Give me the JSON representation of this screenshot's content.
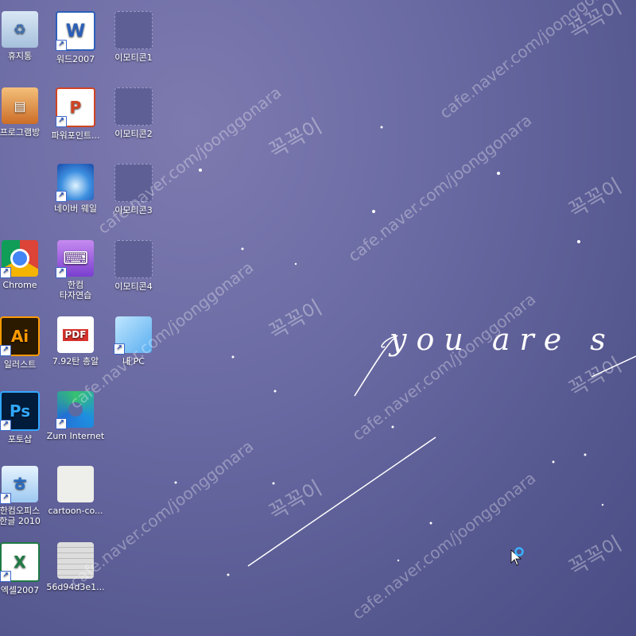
{
  "desktop_icons": [
    {
      "label": "휴지통",
      "icon": "recycle-bin-icon",
      "glyph": "♻",
      "shortcut": false
    },
    {
      "label": "워드2007",
      "icon": "word-icon",
      "glyph": "W",
      "shortcut": true
    },
    {
      "label": "이모티콘1",
      "icon": "emoticon-folder-icon",
      "glyph": "",
      "shortcut": false
    },
    {
      "label": "프로그램방",
      "icon": "program-room-icon",
      "glyph": "▤",
      "shortcut": false
    },
    {
      "label": "파워포인트...",
      "icon": "powerpoint-icon",
      "glyph": "P",
      "shortcut": true
    },
    {
      "label": "이모티콘2",
      "icon": "emoticon-folder-icon",
      "glyph": "",
      "shortcut": false
    },
    {
      "label": "네이버 웨일",
      "icon": "naver-whale-icon",
      "glyph": "",
      "shortcut": true
    },
    {
      "label": "이모티콘3",
      "icon": "emoticon-folder-icon",
      "glyph": "",
      "shortcut": false
    },
    {
      "label": "Chrome",
      "icon": "chrome-icon",
      "glyph": "",
      "shortcut": true
    },
    {
      "label": "한컴\n타자연습",
      "icon": "hancom-typing-icon",
      "glyph": "⌨",
      "shortcut": true
    },
    {
      "label": "이모티콘4",
      "icon": "emoticon-folder-icon",
      "glyph": "",
      "shortcut": false
    },
    {
      "label": "일러스트",
      "icon": "illustrator-icon",
      "glyph": "Ai",
      "shortcut": true
    },
    {
      "label": "7.92탄 총알",
      "icon": "pdf-file-icon",
      "glyph": "PDF",
      "shortcut": false
    },
    {
      "label": "내 PC",
      "icon": "this-pc-icon",
      "glyph": "",
      "shortcut": true
    },
    {
      "label": "포토샵",
      "icon": "photoshop-icon",
      "glyph": "Ps",
      "shortcut": true
    },
    {
      "label": "Zum Internet",
      "icon": "zum-internet-icon",
      "glyph": "",
      "shortcut": true
    },
    {
      "label": "한컴오피스\n한글 2010",
      "icon": "hwp-icon",
      "glyph": "ㅎ",
      "shortcut": true
    },
    {
      "label": "cartoon-co...",
      "icon": "image-file-icon",
      "glyph": "",
      "shortcut": false
    },
    {
      "label": "엑셀2007",
      "icon": "excel-icon",
      "glyph": "X",
      "shortcut": true
    },
    {
      "label": "56d94d3e1...",
      "icon": "image-file-icon",
      "glyph": "",
      "shortcut": false
    }
  ],
  "wallpaper": {
    "script_text": "you are s",
    "watermark_korean": "꼭꼭이",
    "watermark_url": "cafe.naver.com/joonggonara",
    "colors": {
      "top": "#7d7aaf",
      "bottom": "#4a4d85",
      "line": "#ffffff"
    }
  },
  "cursor": {
    "icon": "mouse-pointer-icon",
    "busy_icon": "busy-ring-icon"
  }
}
